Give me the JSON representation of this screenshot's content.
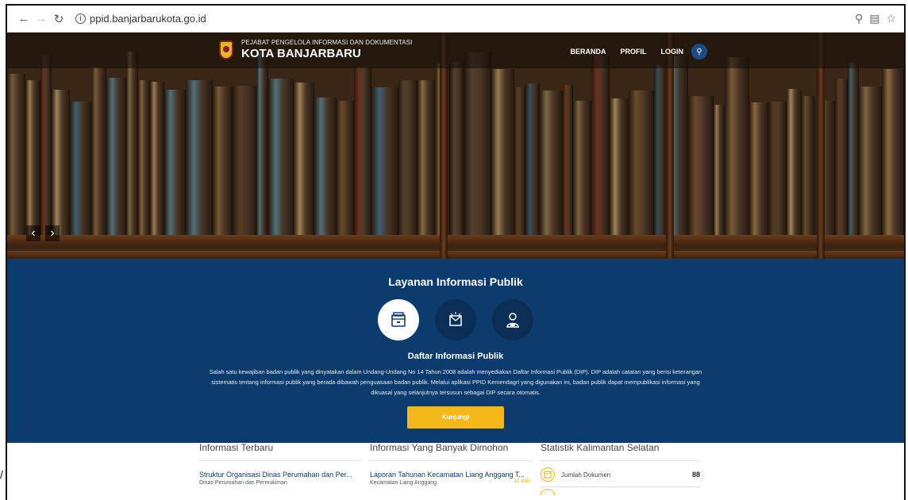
{
  "browser": {
    "url": "ppid.banjarbarukota.go.id",
    "icons": [
      "back-icon",
      "forward-icon",
      "reload-icon",
      "info-icon",
      "zoom-icon",
      "translate-icon",
      "star-icon"
    ]
  },
  "header": {
    "subtitle": "PEJABAT PENGELOLA INFORMASI DAN DOKUMENTASI",
    "title": "KOTA BANJARBARU",
    "nav": [
      "BERANDA",
      "PROFIL",
      "LOGIN"
    ]
  },
  "layanan": {
    "title": "Layanan Informasi Publik",
    "subtitle": "Daftar Informasi Publik",
    "description": "Salah satu kewajiban badan publik yang dinyatakan dalam Undang-Undang No 14 Tahun 2008 adalah menyediakan Daftar Informasi Publik (DIP). DIP adalah catatan yang berisi keterangan sistematis tentang informasi publik yang berada dibawah penguasaan badan publik. Melalui aplikasi PPID Kemendagri yang digunakan ini, badan publik dapat mempublikasi informasi yang dikuasai yang selanjutnya tersusun sebagai DIP secara otomatis.",
    "button": "Kunjungi"
  },
  "columns": {
    "terbaru": {
      "title": "Informasi Terbaru",
      "item_title": "Struktur Organisasi Dinas Perumahan dan Per...",
      "item_sub": "Dinas Perumahan dan Permukiman"
    },
    "dimohon": {
      "title": "Informasi Yang Banyak Dimohon",
      "item_title": "Laporan Tahunan Kecamatan Liang Anggang T...",
      "item_sub": "Kecamatan Liang Anggang",
      "item_count": "11 kali"
    },
    "statistik": {
      "title": "Statistik Kalimantan Selatan",
      "label": "Jumlah Dokumen",
      "value": "88"
    }
  },
  "corner_glyph": "/"
}
